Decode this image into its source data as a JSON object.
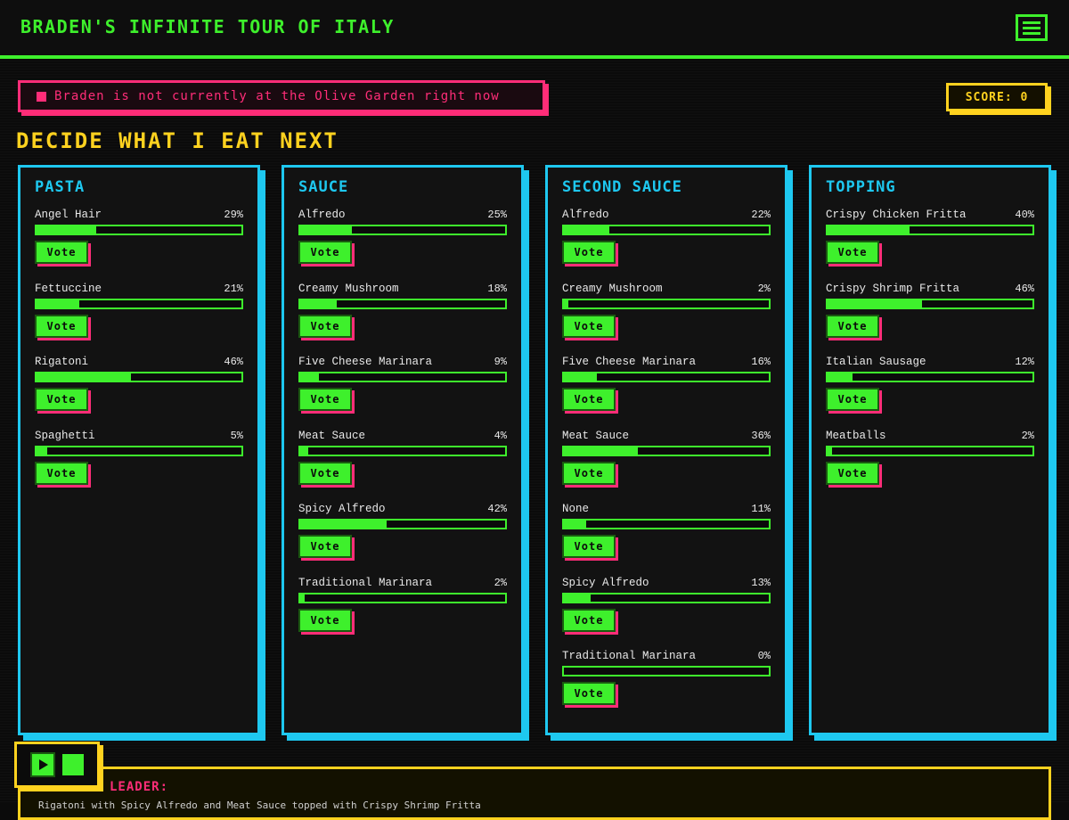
{
  "header": {
    "title": "BRADEN'S INFINITE TOUR OF ITALY",
    "menu_icon": "hamburger-icon"
  },
  "status": {
    "text": "Braden is not currently at the Olive Garden right now"
  },
  "score": {
    "label": "SCORE: 0"
  },
  "heading": "DECIDE WHAT I EAT NEXT",
  "vote_label": "Vote",
  "colors": {
    "green": "#3ef02c",
    "cyan": "#1ec8f0",
    "pink": "#ff2d78",
    "yellow": "#ffd21f"
  },
  "columns": [
    {
      "title": "PASTA",
      "options": [
        {
          "name": "Angel Hair",
          "pct": "29%",
          "value": 29
        },
        {
          "name": "Fettuccine",
          "pct": "21%",
          "value": 21
        },
        {
          "name": "Rigatoni",
          "pct": "46%",
          "value": 46
        },
        {
          "name": "Spaghetti",
          "pct": "5%",
          "value": 5
        }
      ]
    },
    {
      "title": "SAUCE",
      "options": [
        {
          "name": "Alfredo",
          "pct": "25%",
          "value": 25
        },
        {
          "name": "Creamy Mushroom",
          "pct": "18%",
          "value": 18
        },
        {
          "name": "Five Cheese Marinara",
          "pct": "9%",
          "value": 9
        },
        {
          "name": "Meat Sauce",
          "pct": "4%",
          "value": 4
        },
        {
          "name": "Spicy Alfredo",
          "pct": "42%",
          "value": 42
        },
        {
          "name": "Traditional Marinara",
          "pct": "2%",
          "value": 2
        }
      ]
    },
    {
      "title": "SECOND SAUCE",
      "options": [
        {
          "name": "Alfredo",
          "pct": "22%",
          "value": 22
        },
        {
          "name": "Creamy Mushroom",
          "pct": "2%",
          "value": 2
        },
        {
          "name": "Five Cheese Marinara",
          "pct": "16%",
          "value": 16
        },
        {
          "name": "Meat Sauce",
          "pct": "36%",
          "value": 36
        },
        {
          "name": "None",
          "pct": "11%",
          "value": 11
        },
        {
          "name": "Spicy Alfredo",
          "pct": "13%",
          "value": 13
        },
        {
          "name": "Traditional Marinara",
          "pct": "0%",
          "value": 0
        }
      ]
    },
    {
      "title": "TOPPING",
      "options": [
        {
          "name": "Crispy Chicken Fritta",
          "pct": "40%",
          "value": 40
        },
        {
          "name": "Crispy Shrimp Fritta",
          "pct": "46%",
          "value": 46
        },
        {
          "name": "Italian Sausage",
          "pct": "12%",
          "value": 12
        },
        {
          "name": "Meatballs",
          "pct": "2%",
          "value": 2
        }
      ]
    }
  ],
  "leader": {
    "label": "LEADER:",
    "text": "Rigatoni with Spicy Alfredo and Meat Sauce topped with Crispy Shrimp Fritta"
  },
  "player": {
    "play_icon": "play-icon",
    "stop_icon": "stop-icon"
  }
}
